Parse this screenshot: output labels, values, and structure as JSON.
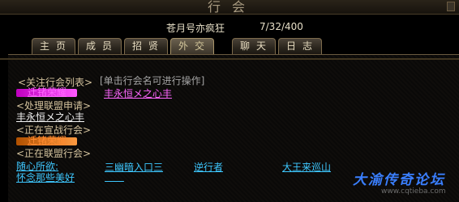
{
  "window": {
    "title": "行会"
  },
  "guild": {
    "name": "苍月号亦疯狂",
    "members": "7/32/400"
  },
  "tabs": [
    {
      "label": "主页",
      "active": false
    },
    {
      "label": "成员",
      "active": false
    },
    {
      "label": "招贤",
      "active": false
    },
    {
      "label": "外交",
      "active": true
    },
    {
      "label": "聊天",
      "active": false
    },
    {
      "label": "日志",
      "active": false
    }
  ],
  "diplomacy": {
    "hint": "[单击行会名可进行操作]",
    "followed_header": "<关注行会列表>",
    "followed_guilds": [
      "迁锗荣耀",
      "丰永恒メ之心丰"
    ],
    "alliance_requests_header": "<处理联盟申请>",
    "alliance_requests": [
      "丰永恒メ之心丰"
    ],
    "war_header": "<正在宣战行会>",
    "war_guilds": [
      "迁锗荣耀"
    ],
    "alliance_header": "<正在联盟行会>",
    "alliance_guilds": [
      "随心所欲:",
      "三幽暗入口三",
      "逆行者",
      "大王来巡山",
      "怀念那些美好"
    ]
  },
  "watermark": {
    "title": "大渝传奇论坛",
    "url": "www.cqtieba.com"
  },
  "colors": {
    "followed": "#ff66ff",
    "request": "#f4f4f4",
    "war": "#ff8a30",
    "ally": "#3ec8ff",
    "header": "#d4c39e"
  }
}
